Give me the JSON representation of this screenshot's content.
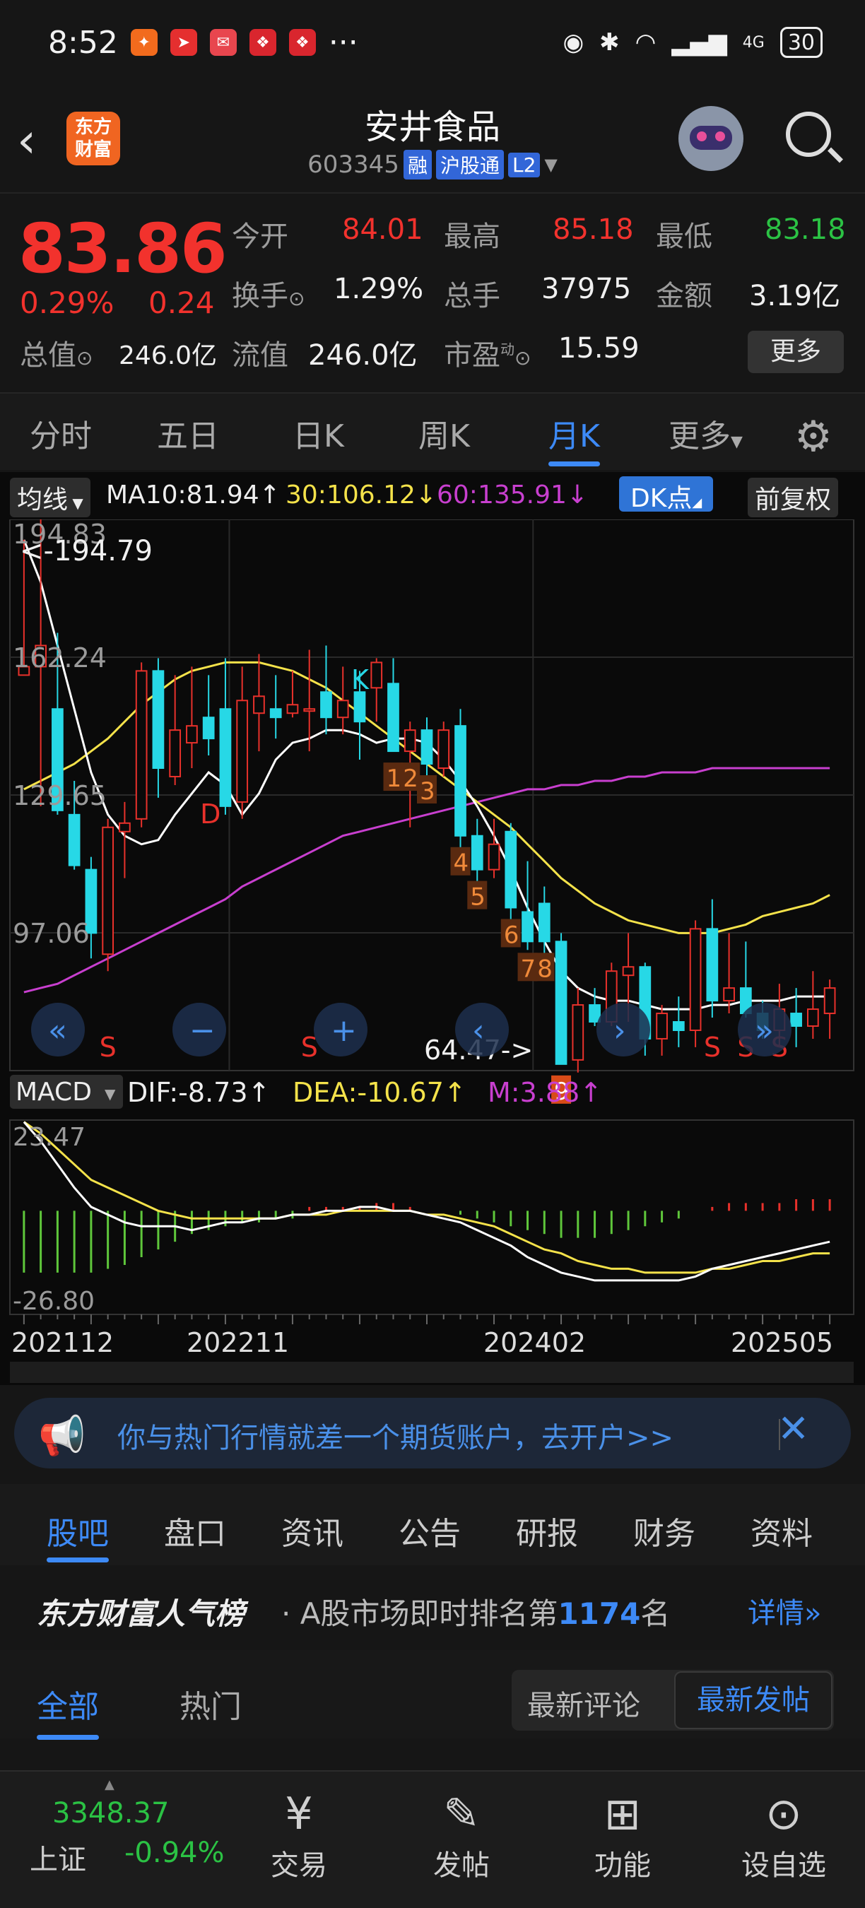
{
  "status_bar": {
    "time": "8:52",
    "battery": "30",
    "network": "4G"
  },
  "header": {
    "logo_text_1": "东方",
    "logo_text_2": "财富",
    "stock_name": "安井食品",
    "stock_code": "603345",
    "tags": [
      "融",
      "沪股通",
      "L2"
    ]
  },
  "quote": {
    "price": "83.86",
    "change_pct": "0.29%",
    "change_amt": "0.24",
    "open_label": "今开",
    "open": "84.01",
    "high_label": "最高",
    "high": "85.18",
    "low_label": "最低",
    "low": "83.18",
    "turnover_label": "换手",
    "turnover": "1.29%",
    "volume_label": "总手",
    "volume": "37975",
    "amount_label": "金额",
    "amount": "3.19亿",
    "mktcap_label": "总值",
    "mktcap": "246.0亿",
    "float_label": "流值",
    "float": "246.0亿",
    "pe_label": "市盈",
    "pe_sup": "动",
    "pe": "15.59",
    "more": "更多"
  },
  "period_tabs": [
    "分时",
    "五日",
    "日K",
    "周K",
    "月K",
    "更多"
  ],
  "ma_bar": {
    "selector": "均线",
    "ma10": "MA10:81.94↑",
    "ma30": "30:106.12↓",
    "ma60": "60:135.91↓",
    "dk": "DK点",
    "adjust": "前复权"
  },
  "chart_data": {
    "type": "candlestick",
    "period": "monthly",
    "y_ticks": [
      "194.83",
      "162.24",
      "129.65",
      "97.06",
      "64.47"
    ],
    "ylim": [
      64.47,
      194.83
    ],
    "x_ticks": [
      "202112",
      "202211",
      "202402",
      "202505"
    ],
    "max_label": "<-194.79",
    "min_label": "64.47->",
    "candles": [
      {
        "o": 158,
        "h": 190,
        "l": 160,
        "c": 160
      },
      {
        "o": 160,
        "h": 195,
        "l": 127,
        "c": 165
      },
      {
        "o": 150,
        "h": 168,
        "l": 125,
        "c": 126
      },
      {
        "o": 125,
        "h": 133,
        "l": 112,
        "c": 113
      },
      {
        "o": 112,
        "h": 115,
        "l": 91,
        "c": 97
      },
      {
        "o": 92,
        "h": 124,
        "l": 88,
        "c": 122
      },
      {
        "o": 121,
        "h": 128,
        "l": 110,
        "c": 123
      },
      {
        "o": 124,
        "h": 161,
        "l": 122,
        "c": 159
      },
      {
        "o": 159,
        "h": 162,
        "l": 129,
        "c": 136
      },
      {
        "o": 134,
        "h": 158,
        "l": 132,
        "c": 145
      },
      {
        "o": 142,
        "h": 160,
        "l": 136,
        "c": 146
      },
      {
        "o": 148,
        "h": 158,
        "l": 139,
        "c": 143
      },
      {
        "o": 150,
        "h": 162,
        "l": 125,
        "c": 127
      },
      {
        "o": 128,
        "h": 160,
        "l": 124,
        "c": 152
      },
      {
        "o": 149,
        "h": 163,
        "l": 140,
        "c": 153
      },
      {
        "o": 150,
        "h": 158,
        "l": 143,
        "c": 148
      },
      {
        "o": 149,
        "h": 159,
        "l": 148,
        "c": 151
      },
      {
        "o": 150,
        "h": 164,
        "l": 140,
        "c": 150
      },
      {
        "o": 154,
        "h": 165,
        "l": 144,
        "c": 148
      },
      {
        "o": 148,
        "h": 160,
        "l": 144,
        "c": 152
      },
      {
        "o": 154,
        "h": 159,
        "l": 138,
        "c": 147
      },
      {
        "o": 155,
        "h": 162,
        "l": 147,
        "c": 161
      },
      {
        "o": 156,
        "h": 162,
        "l": 142,
        "c": 140
      },
      {
        "o": 140,
        "h": 147,
        "l": 122,
        "c": 145
      },
      {
        "o": 145,
        "h": 148,
        "l": 128,
        "c": 137
      },
      {
        "o": 136,
        "h": 147,
        "l": 134,
        "c": 145
      },
      {
        "o": 146,
        "h": 150,
        "l": 117,
        "c": 120
      },
      {
        "o": 120,
        "h": 124,
        "l": 108,
        "c": 112
      },
      {
        "o": 112,
        "h": 124,
        "l": 110,
        "c": 118
      },
      {
        "o": 121,
        "h": 123,
        "l": 98,
        "c": 103
      },
      {
        "o": 102,
        "h": 114,
        "l": 93,
        "c": 95
      },
      {
        "o": 104,
        "h": 108,
        "l": 86,
        "c": 95
      },
      {
        "o": 95,
        "h": 97,
        "l": 68,
        "c": 66
      },
      {
        "o": 67,
        "h": 84,
        "l": 64,
        "c": 80
      },
      {
        "o": 80,
        "h": 84,
        "l": 75,
        "c": 76
      },
      {
        "o": 76,
        "h": 90,
        "l": 75,
        "c": 88
      },
      {
        "o": 87,
        "h": 97,
        "l": 76,
        "c": 89
      },
      {
        "o": 89,
        "h": 90,
        "l": 68,
        "c": 72
      },
      {
        "o": 72,
        "h": 80,
        "l": 68,
        "c": 78
      },
      {
        "o": 76,
        "h": 82,
        "l": 70,
        "c": 74
      },
      {
        "o": 74,
        "h": 100,
        "l": 70,
        "c": 98
      },
      {
        "o": 98,
        "h": 105,
        "l": 77,
        "c": 81
      },
      {
        "o": 81,
        "h": 97,
        "l": 78,
        "c": 84
      },
      {
        "o": 84,
        "h": 95,
        "l": 77,
        "c": 78
      },
      {
        "o": 78,
        "h": 81,
        "l": 72,
        "c": 74
      },
      {
        "o": 74,
        "h": 85,
        "l": 70,
        "c": 79
      },
      {
        "o": 78,
        "h": 84,
        "l": 70,
        "c": 75
      },
      {
        "o": 75,
        "h": 88,
        "l": 72,
        "c": 79
      },
      {
        "o": 78,
        "h": 86,
        "l": 72,
        "c": 84
      }
    ],
    "ma10": [
      190,
      180,
      165,
      150,
      135,
      125,
      120,
      118,
      119,
      125,
      130,
      135,
      132,
      125,
      130,
      138,
      142,
      143,
      145,
      145,
      144,
      142,
      143,
      143,
      142,
      138,
      133,
      127,
      120,
      112,
      103,
      95,
      88,
      84,
      82,
      81,
      81,
      80,
      79,
      79,
      79,
      80,
      80,
      81,
      81,
      81,
      82,
      82,
      82
    ],
    "ma30": [
      131,
      133,
      135,
      137,
      140,
      143,
      147,
      151,
      154,
      157,
      159,
      160,
      161,
      161,
      161,
      160,
      159,
      157,
      155,
      152,
      149,
      146,
      143,
      140,
      137,
      134,
      131,
      128,
      125,
      122,
      118,
      114,
      110,
      107,
      104,
      102,
      100,
      99,
      98,
      97,
      97,
      97,
      98,
      99,
      101,
      102,
      103,
      104,
      106
    ],
    "ma60": [
      83,
      84,
      85,
      87,
      89,
      91,
      93,
      95,
      97,
      99,
      101,
      103,
      105,
      108,
      110,
      112,
      114,
      116,
      118,
      120,
      121,
      122,
      123,
      124,
      125,
      126,
      127,
      128,
      129,
      130,
      131,
      131,
      132,
      132,
      133,
      133,
      134,
      134,
      135,
      135,
      135,
      136,
      136,
      136,
      136,
      136,
      136,
      136,
      136
    ],
    "td_labels": [
      "1",
      "2",
      "3",
      "4",
      "5",
      "6",
      "7",
      "8",
      "9"
    ],
    "signals": [
      "D",
      "K",
      "S",
      "S",
      "S",
      "S",
      "S"
    ]
  },
  "macd": {
    "selector": "MACD",
    "dif": "DIF:-8.73↑",
    "dea": "DEA:-10.67↑",
    "m": "M:3.88↑",
    "ytop": "23.47",
    "ybot": "-26.80",
    "hist": [
      -16,
      -16,
      -16,
      -16,
      -16,
      -15,
      -14,
      -12,
      -10,
      -8,
      -6,
      -5,
      -4,
      -3,
      -3,
      -2,
      -2,
      1,
      1,
      1,
      1,
      2,
      2,
      1,
      0,
      0,
      -1,
      -2,
      -3,
      -4,
      -5,
      -6,
      -7,
      -7,
      -7,
      -6,
      -5,
      -4,
      -3,
      -2,
      0,
      1,
      2,
      2,
      2,
      2,
      3,
      3,
      3
    ],
    "dif_line": [
      23,
      18,
      12,
      6,
      1,
      -1,
      -3,
      -4,
      -4,
      -4,
      -5,
      -4,
      -3,
      -3,
      -2,
      -2,
      -1,
      -1,
      0,
      0,
      1,
      1,
      0,
      0,
      -1,
      -2,
      -3,
      -5,
      -7,
      -9,
      -12,
      -14,
      -16,
      -17,
      -18,
      -18,
      -18,
      -18,
      -18,
      -18,
      -17,
      -15,
      -14,
      -13,
      -12,
      -11,
      -10,
      -9,
      -8
    ],
    "dea_line": [
      23,
      20,
      16,
      12,
      8,
      6,
      4,
      2,
      0,
      -1,
      -2,
      -2,
      -2,
      -2,
      -2,
      -2,
      -1,
      -1,
      -1,
      0,
      0,
      0,
      0,
      0,
      -1,
      -1,
      -2,
      -3,
      -4,
      -6,
      -8,
      -10,
      -11,
      -13,
      -14,
      -15,
      -15,
      -16,
      -16,
      -16,
      -16,
      -15,
      -15,
      -14,
      -13,
      -13,
      -12,
      -11,
      -11
    ]
  },
  "ad": {
    "text": "你与热门行情就差一个期货账户，去开户>>"
  },
  "section_tabs": [
    "股吧",
    "盘口",
    "资讯",
    "公告",
    "研报",
    "财务",
    "资料"
  ],
  "rank": {
    "brand": "东方财富人气榜",
    "text_prefix": "· A股市场即时排名第",
    "rank_num": "1174",
    "text_suffix": "名",
    "detail": "详情"
  },
  "feed_tabs": [
    "全部",
    "热门"
  ],
  "sort": {
    "latest_comment": "最新评论",
    "latest_post": "最新发帖"
  },
  "bottom": {
    "index_value": "3348.37",
    "index_name": "上证",
    "index_pct": "-0.94%",
    "items": [
      "交易",
      "发帖",
      "功能",
      "设自选"
    ]
  }
}
